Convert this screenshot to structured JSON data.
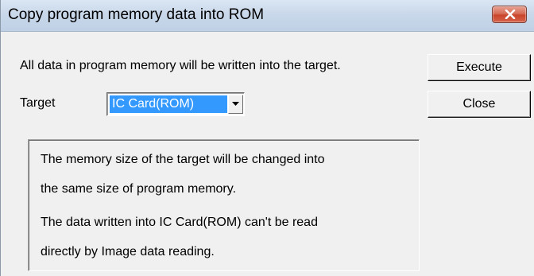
{
  "window": {
    "title": "Copy program memory data into ROM",
    "close_icon": "close-icon",
    "close_color": "#c8452b"
  },
  "dialog": {
    "message": "All data in program memory will be written into the target.",
    "target_label": "Target",
    "target_value": "IC Card(ROM)",
    "dropdown_icon": "chevron-down-icon",
    "selection_color": "#3399ff"
  },
  "buttons": {
    "execute_label": "Execute",
    "close_label": "Close"
  },
  "info": {
    "line1": "The memory size of the target will be changed into",
    "line2": "the same size of program memory.",
    "line3": "The data written into IC Card(ROM) can't be read",
    "line4": "directly by Image data reading."
  }
}
